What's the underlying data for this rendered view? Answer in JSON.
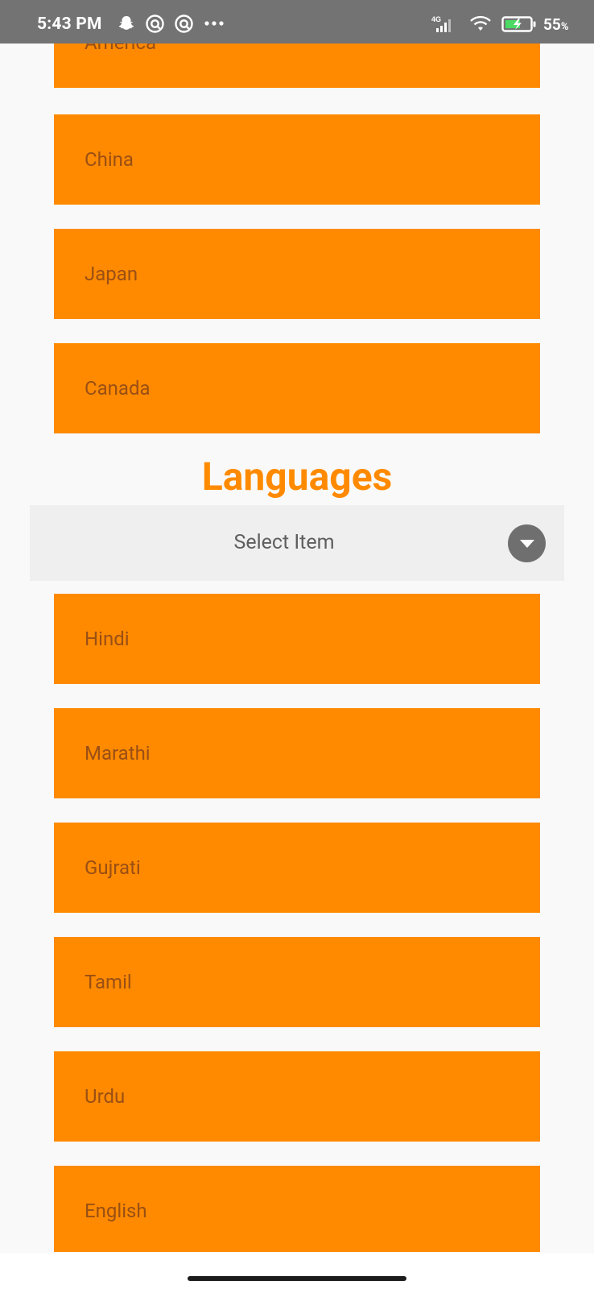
{
  "status_bar": {
    "time": "5:43 PM",
    "notification_icons": [
      "snapchat-icon",
      "vpn-icon",
      "vpn-icon-2",
      "more-dots-icon"
    ],
    "network": "4G",
    "battery_percent": "55",
    "battery_unit": "%"
  },
  "countries": [
    {
      "label": "America"
    },
    {
      "label": "China"
    },
    {
      "label": "Japan"
    },
    {
      "label": "Canada"
    }
  ],
  "languages_section": {
    "title": "Languages",
    "dropdown": {
      "selected": "Select Item"
    },
    "items": [
      {
        "label": "Hindi"
      },
      {
        "label": "Marathi"
      },
      {
        "label": "Gujrati"
      },
      {
        "label": "Tamil"
      },
      {
        "label": "Urdu"
      },
      {
        "label": "English"
      }
    ]
  },
  "colors": {
    "accent": "#ff8a00",
    "card_text": "#9a4f14",
    "status_bar": "#737373",
    "dropdown_bg": "#efefef"
  }
}
